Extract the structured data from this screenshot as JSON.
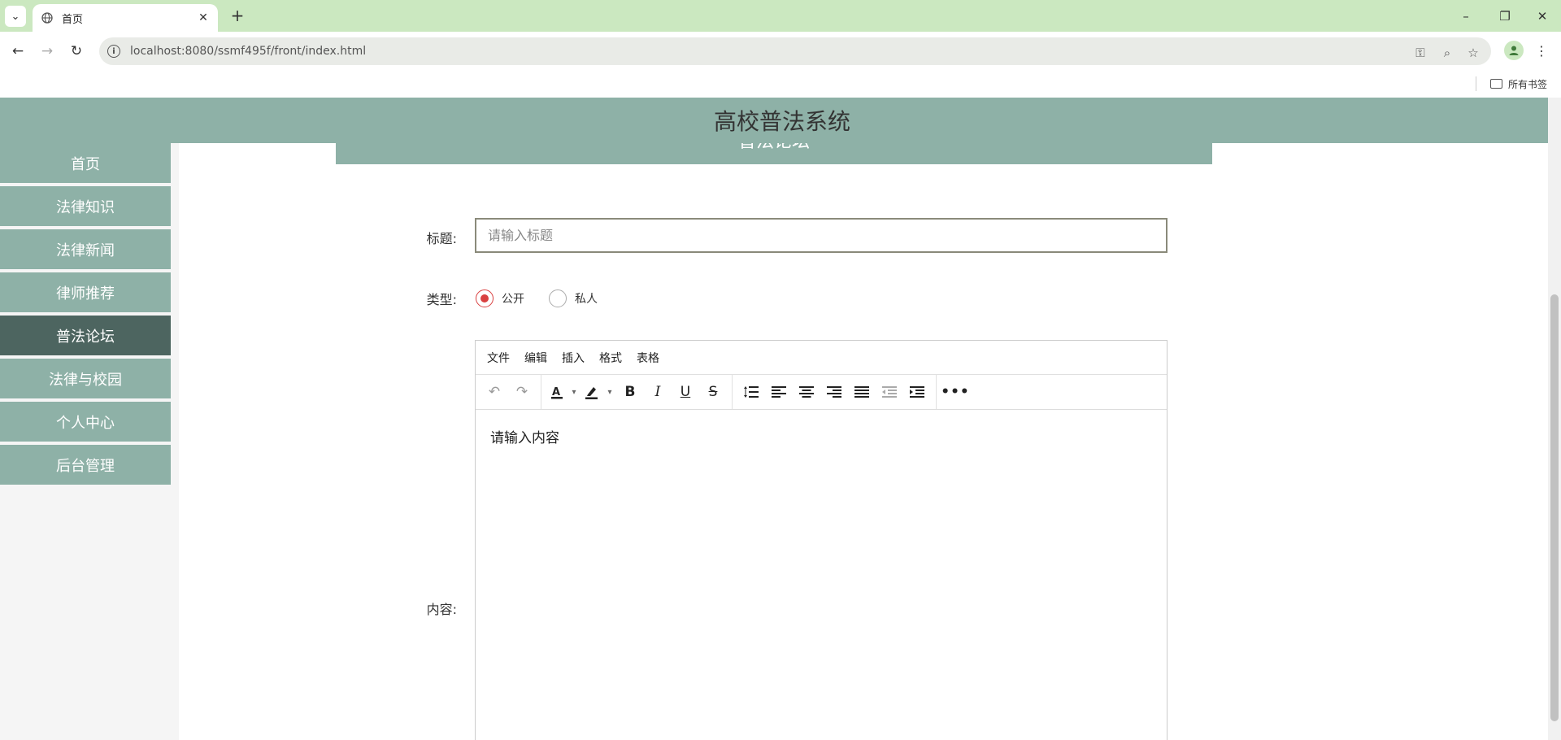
{
  "browser": {
    "tab_title": "首页",
    "url": "localhost:8080/ssmf495f/front/index.html",
    "bookmarks_label": "所有书签"
  },
  "site": {
    "title": "高校普法系统",
    "section_title": "普法论坛"
  },
  "sidebar": {
    "items": [
      {
        "label": "首页",
        "active": false
      },
      {
        "label": "法律知识",
        "active": false
      },
      {
        "label": "法律新闻",
        "active": false
      },
      {
        "label": "律师推荐",
        "active": false
      },
      {
        "label": "普法论坛",
        "active": true
      },
      {
        "label": "法律与校园",
        "active": false
      },
      {
        "label": "个人中心",
        "active": false
      },
      {
        "label": "后台管理",
        "active": false
      }
    ]
  },
  "form": {
    "title_label": "标题:",
    "title_placeholder": "请输入标题",
    "type_label": "类型:",
    "type_options": [
      {
        "label": "公开",
        "selected": true
      },
      {
        "label": "私人",
        "selected": false
      }
    ],
    "content_label": "内容:"
  },
  "editor": {
    "menus": [
      "文件",
      "编辑",
      "插入",
      "格式",
      "表格"
    ],
    "content": "请输入内容"
  },
  "colors": {
    "theme": "#8eb1a7",
    "active_nav": "#4d6560",
    "radio_accent": "#d94040",
    "browser_frame": "#cbe8c0"
  }
}
